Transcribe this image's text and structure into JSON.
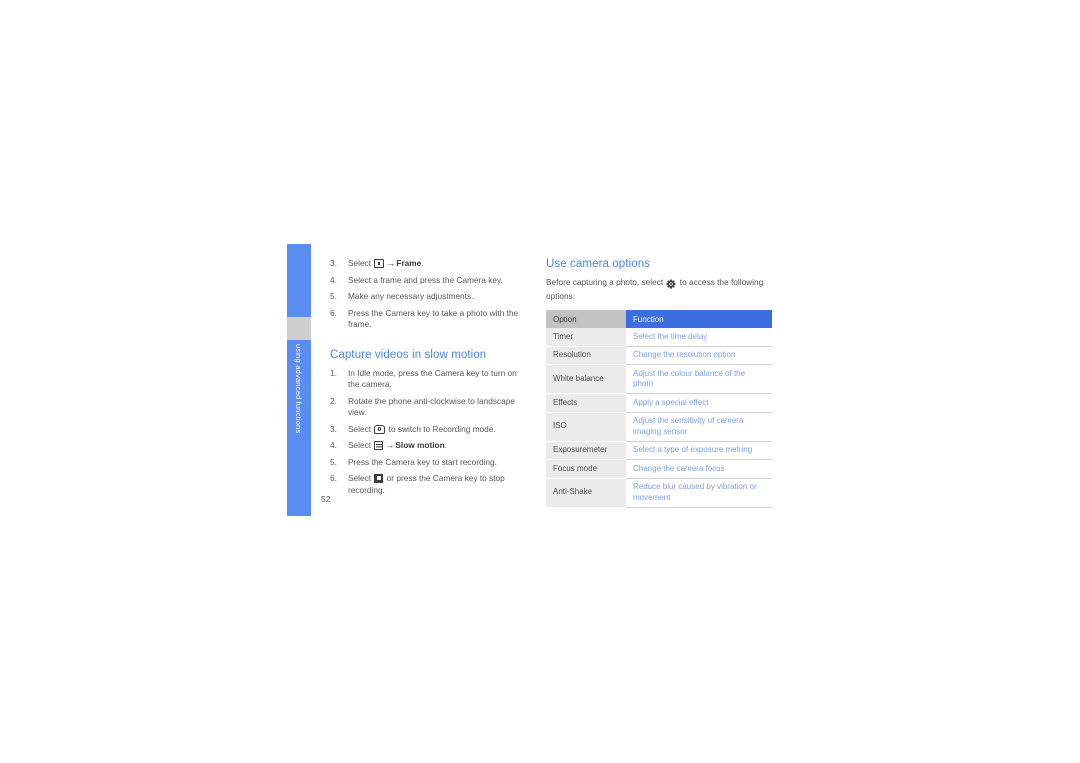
{
  "sidebar": {
    "label": "using advanced functions",
    "accent_color": "#5b8df0",
    "marker_color": "#cfcfcf"
  },
  "page": {
    "number": "52"
  },
  "left_column": {
    "continued_steps": [
      {
        "num": "3.",
        "prefix": "Select ",
        "icon": "frame-icon",
        "middle": " ",
        "arrow": "→",
        "suffix_bold": "Frame",
        "suffix": "."
      },
      {
        "num": "4.",
        "text": "Select a frame and press the Camera key."
      },
      {
        "num": "5.",
        "text": "Make any necessary adjustments."
      },
      {
        "num": "6.",
        "text": "Press the Camera key to take a photo with the frame."
      }
    ],
    "heading": "Capture videos in slow motion",
    "steps": [
      {
        "num": "1.",
        "text": "In Idle mode, press the Camera key to turn on the camera."
      },
      {
        "num": "2.",
        "text": "Rotate the phone anti-clockwise to landscape view."
      },
      {
        "num": "3.",
        "prefix": "Select ",
        "icon": "camera-icon",
        "suffix": " to switch to Recording mode."
      },
      {
        "num": "4.",
        "prefix": "Select ",
        "icon": "recording-mode-icon",
        "arrow": "→",
        "suffix_bold": "Slow motion",
        "suffix": "."
      },
      {
        "num": "5.",
        "text": "Press the Camera key to start recording."
      },
      {
        "num": "6.",
        "prefix": "Select ",
        "icon": "stop-icon",
        "suffix": " or press the Camera key to stop recording."
      }
    ]
  },
  "right_column": {
    "heading": "Use camera options",
    "intro_before": "Before capturing a photo, select ",
    "intro_icon": "gear-icon",
    "intro_after": " to access the following options:",
    "table": {
      "headers": [
        "Option",
        "Function"
      ],
      "header_option_bg": "#c2c2c2",
      "header_function_bg": "#3c6ee0",
      "rows": [
        {
          "option": "Timer",
          "function": "Select the time delay"
        },
        {
          "option": "Resolution",
          "function": "Change the resolution option"
        },
        {
          "option": "White balance",
          "function": "Adjust the colour balance of the photo"
        },
        {
          "option": "Effects",
          "function": "Apply a special effect"
        },
        {
          "option": "ISO",
          "function": "Adjust the sensitivity of camera imaging sensor"
        },
        {
          "option": "Exposuremeter",
          "function": "Select a type of exposure metring"
        },
        {
          "option": "Focus mode",
          "function": "Change the camera focus"
        },
        {
          "option": "Anti-Shake",
          "function": "Reduce blur caused by vibration or movement"
        }
      ]
    }
  }
}
